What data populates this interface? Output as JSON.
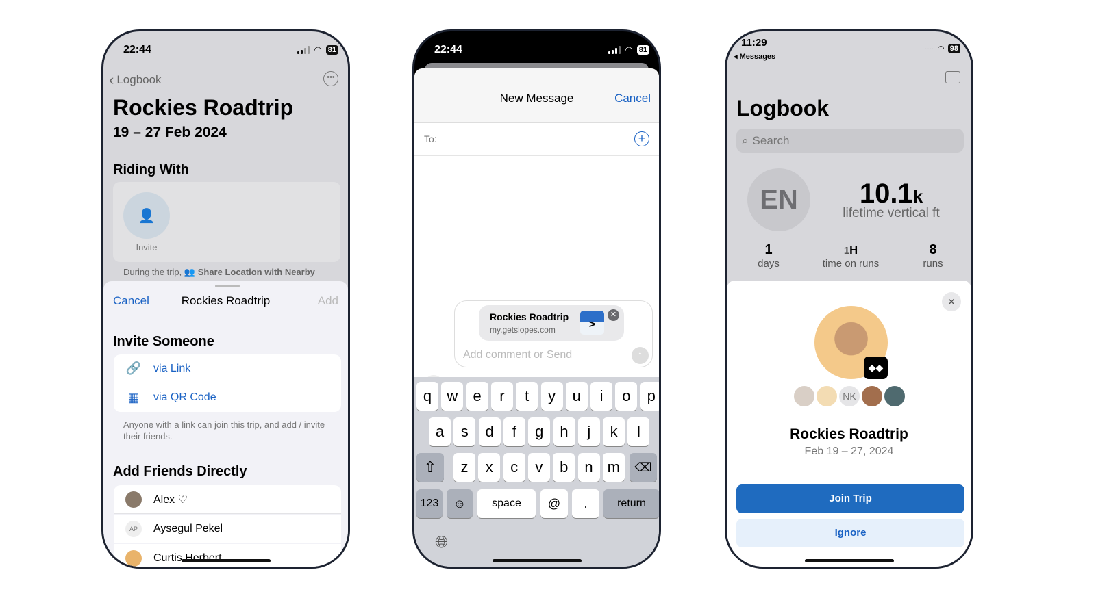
{
  "left": {
    "time": "22:44",
    "battery": "81",
    "back": "Logbook",
    "title": "Rockies Roadtrip",
    "dates": "19 – 27 Feb 2024",
    "riding_with": "Riding With",
    "invite": "Invite",
    "footer_prefix": "During the trip,",
    "footer_link": "Share Location with Nearby",
    "sheet": {
      "cancel": "Cancel",
      "title": "Rockies Roadtrip",
      "add": "Add",
      "invite_heading": "Invite Someone",
      "via_link": "via Link",
      "via_qr": "via QR Code",
      "note": "Anyone with a link can join this trip, and add / invite their friends.",
      "friends_heading": "Add Friends Directly",
      "friends": [
        {
          "name": "Alex ♡",
          "initials": ""
        },
        {
          "name": "Aysegul Pekel",
          "initials": "AP"
        },
        {
          "name": "Curtis Herbert",
          "initials": ""
        }
      ]
    }
  },
  "middle": {
    "time": "22:44",
    "battery": "81",
    "title": "New Message",
    "cancel": "Cancel",
    "to_label": "To:",
    "card_title": "Rockies Roadtrip",
    "card_url": "my.getslopes.com",
    "comment_placeholder": "Add comment or Send",
    "keyboard": {
      "row1": [
        "q",
        "w",
        "e",
        "r",
        "t",
        "y",
        "u",
        "i",
        "o",
        "p"
      ],
      "row2": [
        "a",
        "s",
        "d",
        "f",
        "g",
        "h",
        "j",
        "k",
        "l"
      ],
      "row3": [
        "z",
        "x",
        "c",
        "v",
        "b",
        "n",
        "m"
      ],
      "numbers": "123",
      "space": "space",
      "at": "@",
      "dot": ".",
      "return": "return"
    }
  },
  "right": {
    "time": "11:29",
    "back_app": "Messages",
    "battery": "98",
    "title": "Logbook",
    "search_placeholder": "Search",
    "avatar_initials": "EN",
    "vertical_value": "10.1",
    "vertical_unit": "k",
    "vertical_label": "lifetime vertical ft",
    "stats": [
      {
        "value": "1",
        "unit": "",
        "label": "days"
      },
      {
        "value": "1",
        "unit": "H",
        "label": "time on runs"
      },
      {
        "value": "8",
        "unit": "",
        "label": "runs"
      }
    ],
    "participant_initials": "NK",
    "trip_title": "Rockies Roadtrip",
    "trip_dates": "Feb 19 – 27, 2024",
    "join": "Join Trip",
    "ignore": "Ignore"
  },
  "colors": {
    "accent": "#1a62c4",
    "join_bg": "#1f6bbf",
    "ignore_bg": "#e6f0fb"
  }
}
